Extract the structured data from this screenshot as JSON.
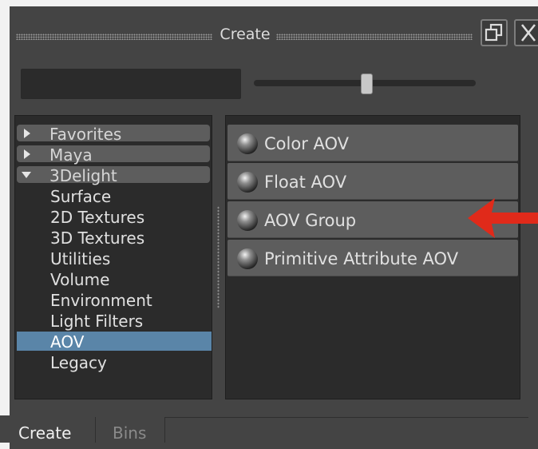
{
  "window": {
    "title": "Create",
    "buttons": [
      "restore-icon",
      "close-icon"
    ]
  },
  "toolbar": {
    "search_value": "",
    "slider_level": 0.51
  },
  "tree": {
    "items": [
      {
        "label": "Favorites",
        "type": "group",
        "expanded": false
      },
      {
        "label": "Maya",
        "type": "group",
        "expanded": false
      },
      {
        "label": "3Delight",
        "type": "group",
        "expanded": true
      },
      {
        "label": "Surface",
        "type": "child"
      },
      {
        "label": "2D Textures",
        "type": "child"
      },
      {
        "label": "3D Textures",
        "type": "child"
      },
      {
        "label": "Utilities",
        "type": "child"
      },
      {
        "label": "Volume",
        "type": "child"
      },
      {
        "label": "Environment",
        "type": "child"
      },
      {
        "label": "Light Filters",
        "type": "child"
      },
      {
        "label": "AOV",
        "type": "child",
        "selected": true
      },
      {
        "label": "Legacy",
        "type": "child"
      }
    ]
  },
  "list": {
    "items": [
      {
        "label": "Color AOV",
        "icon": "sphere-icon"
      },
      {
        "label": "Float AOV",
        "icon": "sphere-icon"
      },
      {
        "label": "AOV Group",
        "icon": "sphere-icon"
      },
      {
        "label": "Primitive Attribute AOV",
        "icon": "sphere-icon"
      }
    ]
  },
  "annotation": {
    "icon": "red-arrow-icon",
    "color": "#e02a1a"
  },
  "tabs": [
    {
      "label": "Create",
      "active": true
    },
    {
      "label": "Bins",
      "active": false
    }
  ],
  "colors": {
    "selection": "#5a85a8",
    "panel": "#2b2b2b",
    "window": "#444444"
  }
}
